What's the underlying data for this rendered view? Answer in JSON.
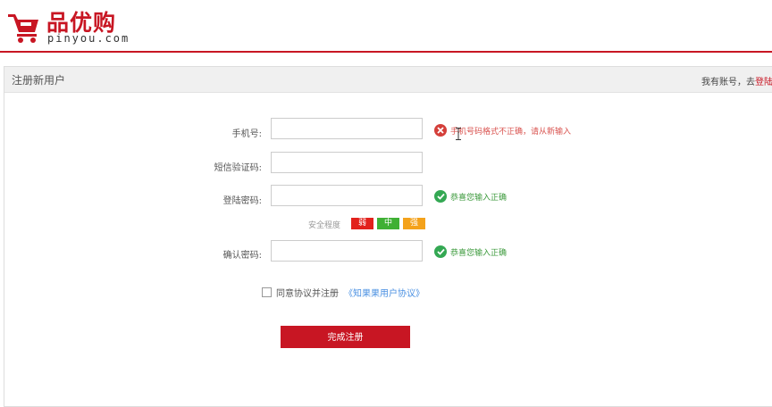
{
  "logo": {
    "cn": "品优购",
    "en": "pinyou.com",
    "icon": "shopping-cart-icon"
  },
  "panel": {
    "title": "注册新用户",
    "login_prefix": "我有账号，去",
    "login_link": "登陆"
  },
  "form": {
    "phone_label": "手机号:",
    "phone_error": "手机号码格式不正确，请从新输入",
    "sms_label": "短信验证码:",
    "password_label": "登陆密码:",
    "password_ok": "恭喜您输入正确",
    "strength_label": "安全程度",
    "strength_weak": "弱",
    "strength_mid": "中",
    "strength_strong": "强",
    "confirm_label": "确认密码:",
    "confirm_ok": "恭喜您输入正确",
    "agree_text": "同意协议并注册",
    "agree_link": "《知果果用户协议》",
    "submit_label": "完成注册"
  },
  "colors": {
    "brand": "#c81623",
    "success": "#34a853",
    "error": "#d43f3a",
    "link": "#4a90e2"
  }
}
